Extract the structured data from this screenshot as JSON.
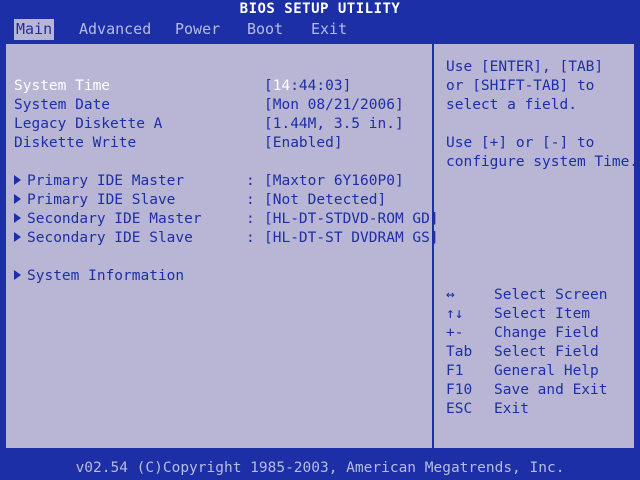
{
  "title": "BIOS SETUP UTILITY",
  "menu": [
    "Main",
    "Advanced",
    "Power",
    "Boot",
    "Exit"
  ],
  "active_menu": "Main",
  "settings": [
    {
      "label": "System Time",
      "value_prefix": "[",
      "value_highlight": "14",
      "value_suffix": ":44:03]"
    },
    {
      "label": "System Date",
      "value": "[Mon 08/21/2006]"
    },
    {
      "label": "Legacy Diskette A",
      "value": "[1.44M, 3.5 in.]"
    },
    {
      "label": "Diskette Write",
      "value": "[Enabled]"
    }
  ],
  "devices": [
    {
      "label": "Primary IDE Master",
      "value": "[Maxtor 6Y160P0]"
    },
    {
      "label": "Primary IDE Slave",
      "value": "[Not Detected]"
    },
    {
      "label": "Secondary IDE Master",
      "value": "[HL-DT-STDVD-ROM GD]"
    },
    {
      "label": "Secondary IDE Slave",
      "value": "[HL-DT-ST DVDRAM GS]"
    }
  ],
  "system_info_label": "System Information",
  "help_text": [
    "Use [ENTER], [TAB]",
    "or [SHIFT-TAB] to",
    "select a field.",
    "",
    "Use [+] or [-] to",
    "configure system Time."
  ],
  "keys": [
    {
      "key": "↔",
      "desc": "Select Screen"
    },
    {
      "key": "↑↓",
      "desc": "Select Item"
    },
    {
      "key": "+-",
      "desc": "Change Field"
    },
    {
      "key": "Tab",
      "desc": "Select Field"
    },
    {
      "key": "F1",
      "desc": "General Help"
    },
    {
      "key": "F10",
      "desc": "Save and Exit"
    },
    {
      "key": "ESC",
      "desc": "Exit"
    }
  ],
  "footer": "v02.54 (C)Copyright 1985-2003, American Megatrends, Inc.",
  "colors": {
    "background": "#1c2fa6",
    "panel": "#b9b5d4",
    "text_blue": "#1c2fa6",
    "text_white": "#ffffff"
  }
}
